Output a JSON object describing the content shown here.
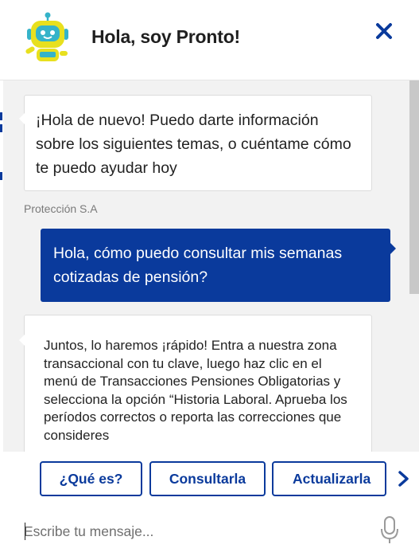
{
  "header": {
    "title": "Hola, soy Pronto!",
    "avatar_icon": "robot-avatar-icon",
    "close_icon": "close-icon"
  },
  "messages": [
    {
      "from": "bot",
      "text": "¡Hola de nuevo! Puedo darte información sobre los siguientes temas, o cuéntame cómo te puedo ayudar hoy",
      "sender": "Protección S.A"
    },
    {
      "from": "user",
      "text": "Hola, cómo puedo consultar mis semanas cotizadas de pensión?"
    },
    {
      "from": "bot",
      "text": "Juntos, lo haremos ¡rápido! Entra a nuestra zona transaccional con tu clave, luego haz clic en el menú de Transacciones Pensiones Obligatorias y selecciona la opción “Historia Laboral. Aprueba los períodos correctos o reporta las correcciones que consideres"
    }
  ],
  "quick_replies": [
    "¿Qué es?",
    "Consultarla",
    "Actualizarla"
  ],
  "input": {
    "placeholder": "Escribe tu mensaje...",
    "value": ""
  },
  "colors": {
    "brand_blue": "#0a3a9c",
    "chat_background": "#f2f2f2",
    "avatar_yellow": "#e8e01e",
    "avatar_teal": "#35b3c9"
  }
}
